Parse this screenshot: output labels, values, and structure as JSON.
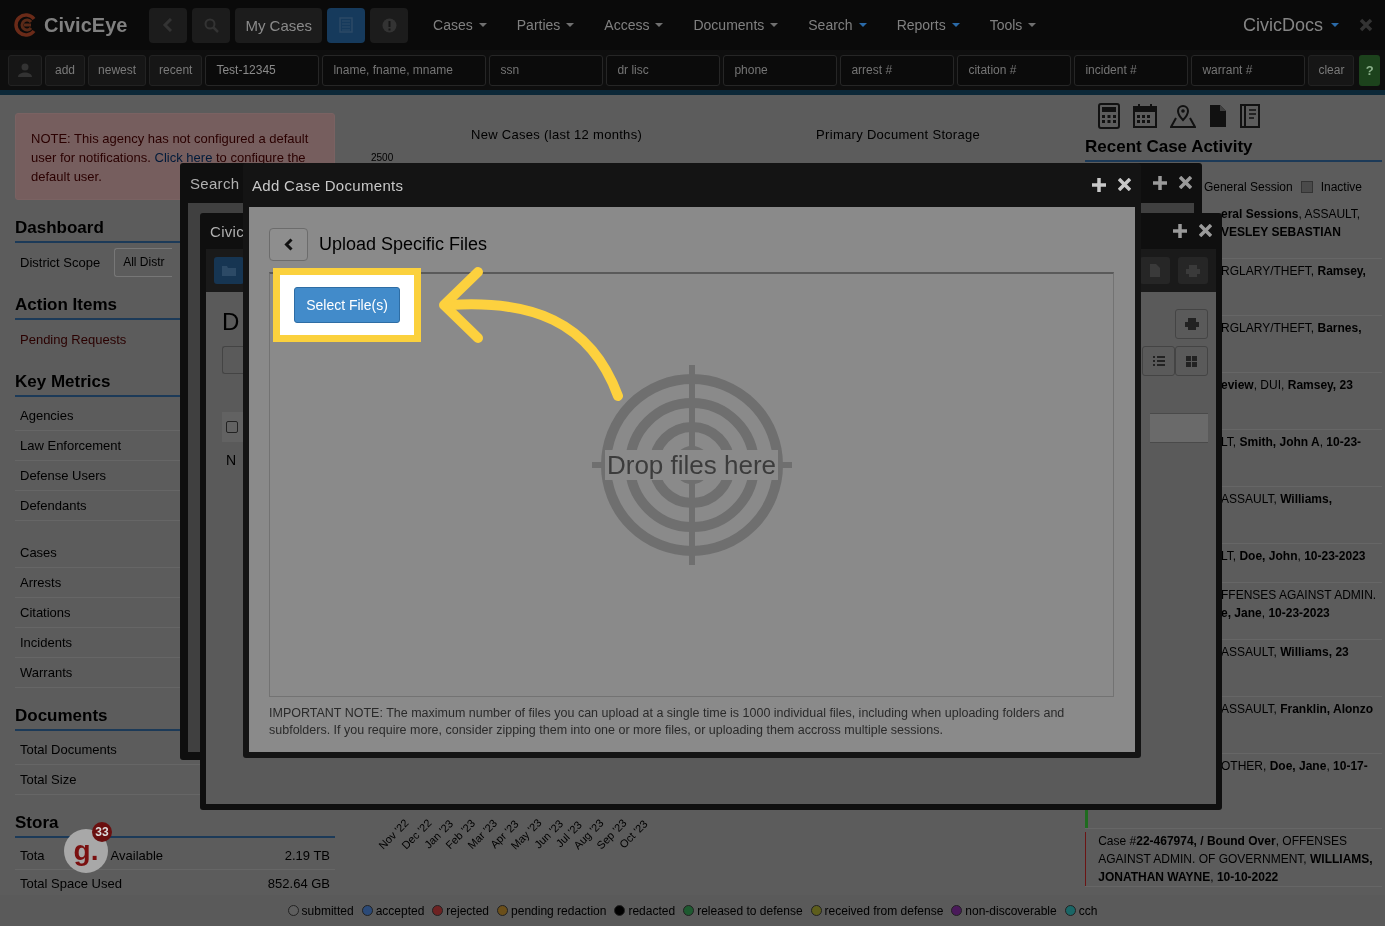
{
  "navbar": {
    "brand": "CivicEye",
    "buttons": [
      {
        "kind": "back",
        "selected": false
      },
      {
        "kind": "search",
        "selected": false
      },
      {
        "kind": "text",
        "label": "My Cases",
        "selected": false
      },
      {
        "kind": "list",
        "selected": true
      },
      {
        "kind": "alert",
        "selected": false
      }
    ],
    "menus": [
      {
        "label": "Cases",
        "accent": false
      },
      {
        "label": "Parties",
        "accent": false
      },
      {
        "label": "Access",
        "accent": false
      },
      {
        "label": "Documents",
        "accent": false
      },
      {
        "label": "Search",
        "accent": true
      },
      {
        "label": "Reports",
        "accent": true
      },
      {
        "label": "Tools",
        "accent": false
      }
    ],
    "app_switcher": {
      "label": "CivicDocs",
      "accent": true
    }
  },
  "search_bar": {
    "buttons": [
      {
        "kind": "user"
      },
      {
        "kind": "text",
        "label": "add"
      },
      {
        "kind": "text",
        "label": "newest"
      },
      {
        "kind": "text",
        "label": "recent"
      }
    ],
    "fields": [
      {
        "kind": "short",
        "value": "Test-12345"
      },
      {
        "kind": "wide",
        "placeholder": "lname, fname, mname"
      },
      {
        "kind": "short",
        "placeholder": "ssn"
      },
      {
        "kind": "short",
        "placeholder": "dr lisc"
      },
      {
        "kind": "short",
        "placeholder": "phone"
      },
      {
        "kind": "short",
        "placeholder": "arrest #"
      },
      {
        "kind": "short",
        "placeholder": "citation #"
      },
      {
        "kind": "short",
        "placeholder": "incident #"
      },
      {
        "kind": "short",
        "placeholder": "warrant #"
      }
    ],
    "clear": "clear",
    "help": "?"
  },
  "sidebar": {
    "notice": {
      "text": "NOTE: This agency has not configured a default user for notifications.",
      "link": "Click here",
      "after": "to configure the default user."
    },
    "sections": [
      {
        "title": "Dashboard",
        "groups": [
          [
            {
              "kind": "select",
              "label": "District Scope",
              "value": "All Distr"
            }
          ]
        ]
      },
      {
        "title": "Action Items",
        "groups": [
          [
            {
              "kind": "link",
              "label": "Pending Requests"
            }
          ]
        ]
      },
      {
        "title": "Key Metrics",
        "groups": [
          [
            {
              "kind": "metric",
              "label": "Agencies"
            },
            {
              "kind": "metric",
              "label": "Law Enforcement"
            },
            {
              "kind": "metric",
              "label": "Defense Users"
            },
            {
              "kind": "metric",
              "label": "Defendants"
            }
          ],
          [
            {
              "kind": "metric",
              "label": "Cases"
            },
            {
              "kind": "metric",
              "label": "Arrests"
            },
            {
              "kind": "metric",
              "label": "Citations"
            },
            {
              "kind": "metric",
              "label": "Incidents"
            },
            {
              "kind": "metric",
              "label": "Warrants"
            }
          ]
        ]
      },
      {
        "title": "Documents",
        "groups": [
          [
            {
              "kind": "metric",
              "label": "Total Documents"
            },
            {
              "kind": "metric",
              "label": "Total Size"
            }
          ]
        ]
      },
      {
        "title": "Stora",
        "groups": [
          [
            {
              "kind": "value",
              "label": "Tota",
              "label_tail": "Available",
              "value": "2.19 TB"
            },
            {
              "kind": "value",
              "label": "Total Space Used",
              "value": "852.64 GB"
            }
          ]
        ]
      }
    ]
  },
  "charts_area": {
    "new_cases_title": "New Cases (last 12 months)",
    "y_tick": "2500",
    "storage_title": "Primary Document Storage",
    "months": [
      "Nov '22",
      "Dec '22",
      "Jan '23",
      "Feb '23",
      "Mar '23",
      "Apr '23",
      "May '23",
      "Jun '23",
      "Jul '23",
      "Aug '23",
      "Sep '23",
      "Oct '23"
    ]
  },
  "activity": {
    "tools": [
      {
        "kind": "calculator"
      },
      {
        "kind": "calendar"
      },
      {
        "kind": "map"
      },
      {
        "kind": "file"
      },
      {
        "kind": "book"
      }
    ],
    "title": "Recent Case Activity",
    "legend": [
      {
        "label": "General Session",
        "kind": "text"
      },
      {
        "label": "Inactive",
        "kind": "swatch"
      }
    ],
    "entries": [
      {
        "clipped": true,
        "text": "**eral Sessions**, ASSAULT, **VESLEY SEBASTIAN**"
      },
      {
        "clipped": true,
        "text": "RGLARY/THEFT, **Ramsey,**"
      },
      {
        "clipped": true,
        "text": "RGLARY/THEFT, **Barnes,**"
      },
      {
        "clipped": true,
        "text": "**eview**, DUI, **Ramsey, 23**"
      },
      {
        "clipped": true,
        "text": "LT, **Smith, John A**, **10-23-**"
      },
      {
        "clipped": true,
        "text": "ASSAULT, **Williams,**"
      },
      {
        "clipped": true,
        "text": "LT, **Doe, John**, **10-23-2023**"
      },
      {
        "clipped": true,
        "text": "FFENSES AGAINST ADMIN. **e, Jane**, **10-23-2023**"
      },
      {
        "clipped": true,
        "text": "ASSAULT, **Williams, 23**"
      },
      {
        "clipped": true,
        "text": "ASSAULT, **Franklin, Alonzo**"
      },
      {
        "clipped": true,
        "color": "#1f6b1f",
        "text": "OTHER, **Doe, Jane**, **10-17-**"
      },
      {
        "clipped": false,
        "color": "#6b1414",
        "text": "Case #**22-467974, / Bound Over**, OFFENSES AGAINST ADMIN. OF GOVERNMENT, **WILLIAMS, JONATHAN WAYNE**, **10-10-2022**"
      }
    ]
  },
  "search_window": {
    "title": "Search"
  },
  "civic_window": {
    "title": "Civic",
    "heading": "D",
    "checked": false,
    "row_label": "N"
  },
  "upload_dialog": {
    "title": "Add Case Documents",
    "heading": "Upload Specific Files",
    "select_button": "Select File(s)",
    "highlighted": true,
    "drop_hint": "Drop files here",
    "note": "IMPORTANT NOTE: The maximum number of files you can upload at a single time is 1000 individual files, including when uploading folders and subfolders. If you require more, consider zipping them into one or more files, or uploading them accross multiple sessions."
  },
  "helper_badge": {
    "logo": "g.",
    "count": "33"
  },
  "status_legend": [
    {
      "label": "submitted",
      "color": "#5e5e5e"
    },
    {
      "label": "accepted",
      "color": "#2b4a78"
    },
    {
      "label": "rejected",
      "color": "#6e2222"
    },
    {
      "label": "pending redaction",
      "color": "#6b4f1a"
    },
    {
      "label": "redacted",
      "color": "#000000"
    },
    {
      "label": "released to defense",
      "color": "#1e5a30"
    },
    {
      "label": "received from defense",
      "color": "#5e5e1c"
    },
    {
      "label": "non-discoverable",
      "color": "#4a1a5a"
    },
    {
      "label": "cch",
      "color": "#1a6666"
    }
  ]
}
